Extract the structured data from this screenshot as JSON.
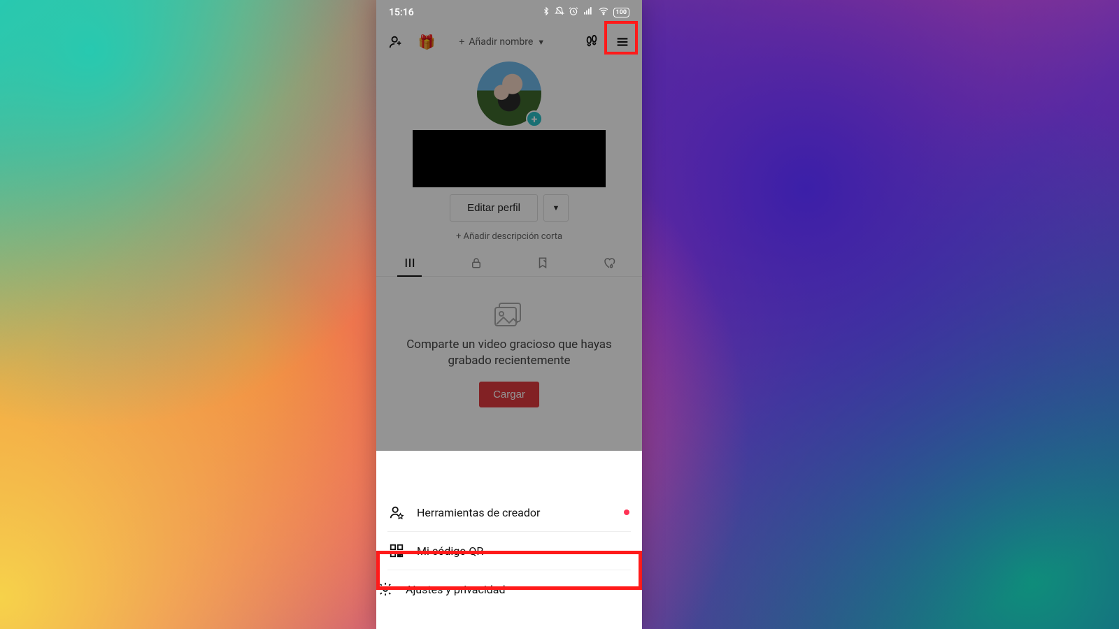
{
  "status": {
    "time": "15:16",
    "icons": {
      "bluetooth": "bt",
      "dnd": "dnd",
      "alarm": "alarm",
      "signal": "sig",
      "wifi": "wifi"
    },
    "battery_text": "100"
  },
  "header": {
    "add_name_label": "Añadir nombre"
  },
  "profile": {
    "edit_label": "Editar perfil",
    "add_bio_label": "+ Añadir descripción corta"
  },
  "empty": {
    "message": "Comparte un video gracioso que hayas grabado recientemente",
    "upload_label": "Cargar"
  },
  "sheet": {
    "items": [
      {
        "icon": "creator",
        "label": "Herramientas de creador",
        "dot": true
      },
      {
        "icon": "qr",
        "label": "Mi código QR",
        "dot": false
      },
      {
        "icon": "settings",
        "label": "Ajustes y privacidad",
        "dot": false
      }
    ]
  },
  "colors": {
    "highlight": "#ff1a1a",
    "primary_button": "#e1393e",
    "avatar_plus": "#2cc0c6"
  }
}
